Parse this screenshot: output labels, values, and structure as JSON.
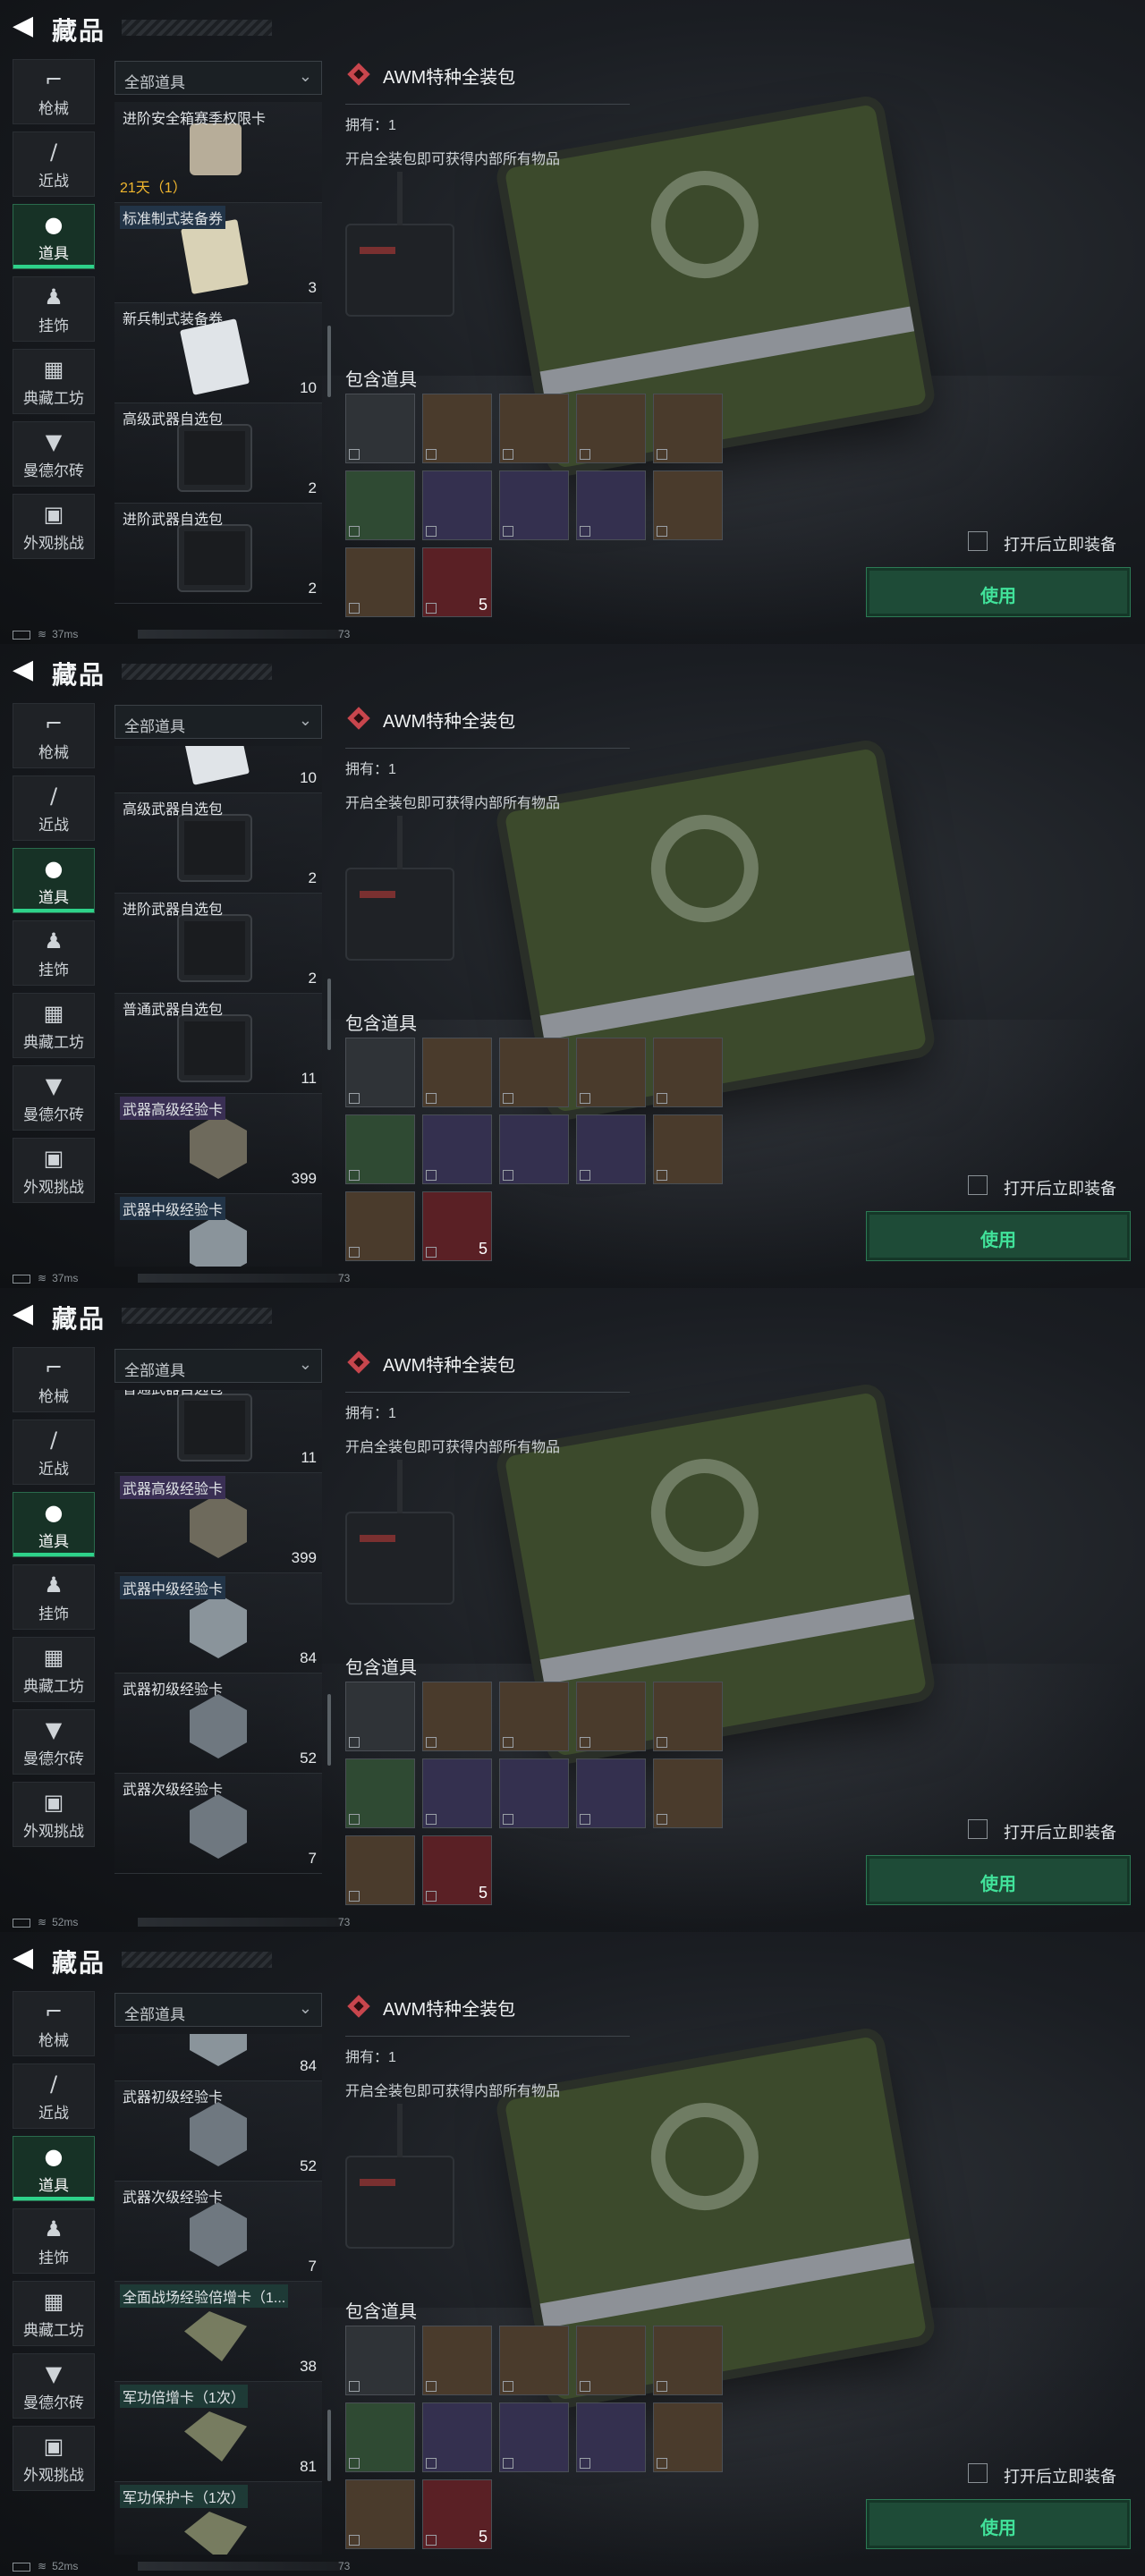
{
  "screens": [
    {
      "header": {
        "title": "藏品"
      },
      "filter": {
        "label": "全部道具"
      },
      "sidebar": [
        {
          "label": "枪械",
          "icon": "gun-icon"
        },
        {
          "label": "近战",
          "icon": "knife-icon"
        },
        {
          "label": "道具",
          "icon": "grenade-icon",
          "active": true
        },
        {
          "label": "挂饰",
          "icon": "charm-icon"
        },
        {
          "label": "典藏工坊",
          "icon": "workshop-icon"
        },
        {
          "label": "曼德尔砖",
          "icon": "brick-icon"
        },
        {
          "label": "外观挑战",
          "icon": "challenge-icon"
        }
      ],
      "items": [
        {
          "name": "进阶安全箱赛季权限卡",
          "timer": "21天（1）",
          "count": "",
          "thumb": "case"
        },
        {
          "name": "标准制式装备券",
          "tag": "blue",
          "count": "3",
          "thumb": "paper"
        },
        {
          "name": "新兵制式装备券",
          "count": "10",
          "thumb": "paper2"
        },
        {
          "name": "高级武器自选包",
          "count": "2",
          "thumb": "box"
        },
        {
          "name": "进阶武器自选包",
          "count": "2",
          "thumb": "box"
        }
      ],
      "detail": {
        "name": "AWM特种全装包",
        "owned": "拥有：1",
        "desc": "开启全装包即可获得内部所有物品",
        "contents_title": "包含道具",
        "auto_equip": "打开后立即装备",
        "use": "使用"
      },
      "status": {
        "ping": "37ms",
        "num": "73"
      }
    },
    {
      "header": {
        "title": "藏品"
      },
      "filter": {
        "label": "全部道具"
      },
      "sidebar": [
        {
          "label": "枪械",
          "icon": "gun-icon"
        },
        {
          "label": "近战",
          "icon": "knife-icon"
        },
        {
          "label": "道具",
          "icon": "grenade-icon",
          "active": true
        },
        {
          "label": "挂饰",
          "icon": "charm-icon"
        },
        {
          "label": "典藏工坊",
          "icon": "workshop-icon"
        },
        {
          "label": "曼德尔砖",
          "icon": "brick-icon"
        },
        {
          "label": "外观挑战",
          "icon": "challenge-icon"
        }
      ],
      "items": [
        {
          "name": "",
          "count": "10",
          "thumb": "paper2"
        },
        {
          "name": "高级武器自选包",
          "count": "2",
          "thumb": "box"
        },
        {
          "name": "进阶武器自选包",
          "count": "2",
          "thumb": "box"
        },
        {
          "name": "普通武器自选包",
          "count": "11",
          "thumb": "box"
        },
        {
          "name": "武器高级经验卡",
          "tag": "purple",
          "count": "399",
          "thumb": "hex"
        },
        {
          "name": "武器中级经验卡",
          "tag": "blue",
          "count": "",
          "thumb": "hex silver"
        }
      ],
      "detail": {
        "name": "AWM特种全装包",
        "owned": "拥有：1",
        "desc": "开启全装包即可获得内部所有物品",
        "contents_title": "包含道具",
        "auto_equip": "打开后立即装备",
        "use": "使用"
      },
      "status": {
        "ping": "37ms",
        "num": "73"
      }
    },
    {
      "header": {
        "title": "藏品"
      },
      "filter": {
        "label": "全部道具"
      },
      "sidebar": [
        {
          "label": "枪械",
          "icon": "gun-icon"
        },
        {
          "label": "近战",
          "icon": "knife-icon"
        },
        {
          "label": "道具",
          "icon": "grenade-icon",
          "active": true
        },
        {
          "label": "挂饰",
          "icon": "charm-icon"
        },
        {
          "label": "典藏工坊",
          "icon": "workshop-icon"
        },
        {
          "label": "曼德尔砖",
          "icon": "brick-icon"
        },
        {
          "label": "外观挑战",
          "icon": "challenge-icon"
        }
      ],
      "items": [
        {
          "name": "普通武器自选包",
          "count": "11",
          "thumb": "box"
        },
        {
          "name": "武器高级经验卡",
          "tag": "purple",
          "count": "399",
          "thumb": "hex"
        },
        {
          "name": "武器中级经验卡",
          "tag": "blue",
          "count": "84",
          "thumb": "hex silver"
        },
        {
          "name": "武器初级经验卡",
          "count": "52",
          "thumb": "hex dark"
        },
        {
          "name": "武器次级经验卡",
          "count": "7",
          "thumb": "hex dark"
        }
      ],
      "detail": {
        "name": "AWM特种全装包",
        "owned": "拥有：1",
        "desc": "开启全装包即可获得内部所有物品",
        "contents_title": "包含道具",
        "auto_equip": "打开后立即装备",
        "use": "使用"
      },
      "status": {
        "ping": "52ms",
        "num": "73"
      }
    },
    {
      "header": {
        "title": "藏品"
      },
      "filter": {
        "label": "全部道具"
      },
      "sidebar": [
        {
          "label": "枪械",
          "icon": "gun-icon"
        },
        {
          "label": "近战",
          "icon": "knife-icon"
        },
        {
          "label": "道具",
          "icon": "grenade-icon",
          "active": true
        },
        {
          "label": "挂饰",
          "icon": "charm-icon"
        },
        {
          "label": "典藏工坊",
          "icon": "workshop-icon"
        },
        {
          "label": "曼德尔砖",
          "icon": "brick-icon"
        },
        {
          "label": "外观挑战",
          "icon": "challenge-icon"
        }
      ],
      "items": [
        {
          "name": "",
          "count": "84",
          "thumb": "hex silver"
        },
        {
          "name": "武器初级经验卡",
          "count": "52",
          "thumb": "hex dark"
        },
        {
          "name": "武器次级经验卡",
          "count": "7",
          "thumb": "hex dark"
        },
        {
          "name": "全面战场经验倍增卡（1...",
          "tag": "green",
          "count": "38",
          "thumb": "tanks"
        },
        {
          "name": "军功倍增卡（1次）",
          "tag": "green",
          "count": "81",
          "thumb": "tanks"
        },
        {
          "name": "军功保护卡（1次）",
          "tag": "green",
          "count": "",
          "thumb": "tanks"
        }
      ],
      "detail": {
        "name": "AWM特种全装包",
        "owned": "拥有：1",
        "desc": "开启全装包即可获得内部所有物品",
        "contents_title": "包含道具",
        "auto_equip": "打开后立即装备",
        "use": "使用"
      },
      "status": {
        "ping": "52ms",
        "num": "73"
      }
    }
  ],
  "contents_grid": [
    {
      "color": "gray",
      "count": ""
    },
    {
      "color": "brown",
      "count": ""
    },
    {
      "color": "brown",
      "count": ""
    },
    {
      "color": "brown",
      "count": ""
    },
    {
      "color": "brown",
      "count": ""
    },
    {
      "color": "green",
      "count": ""
    },
    {
      "color": "purple",
      "count": ""
    },
    {
      "color": "purple",
      "count": ""
    },
    {
      "color": "purple",
      "count": ""
    },
    {
      "color": "brown",
      "count": ""
    },
    {
      "color": "brown",
      "count": ""
    },
    {
      "color": "red",
      "count": "5"
    }
  ]
}
